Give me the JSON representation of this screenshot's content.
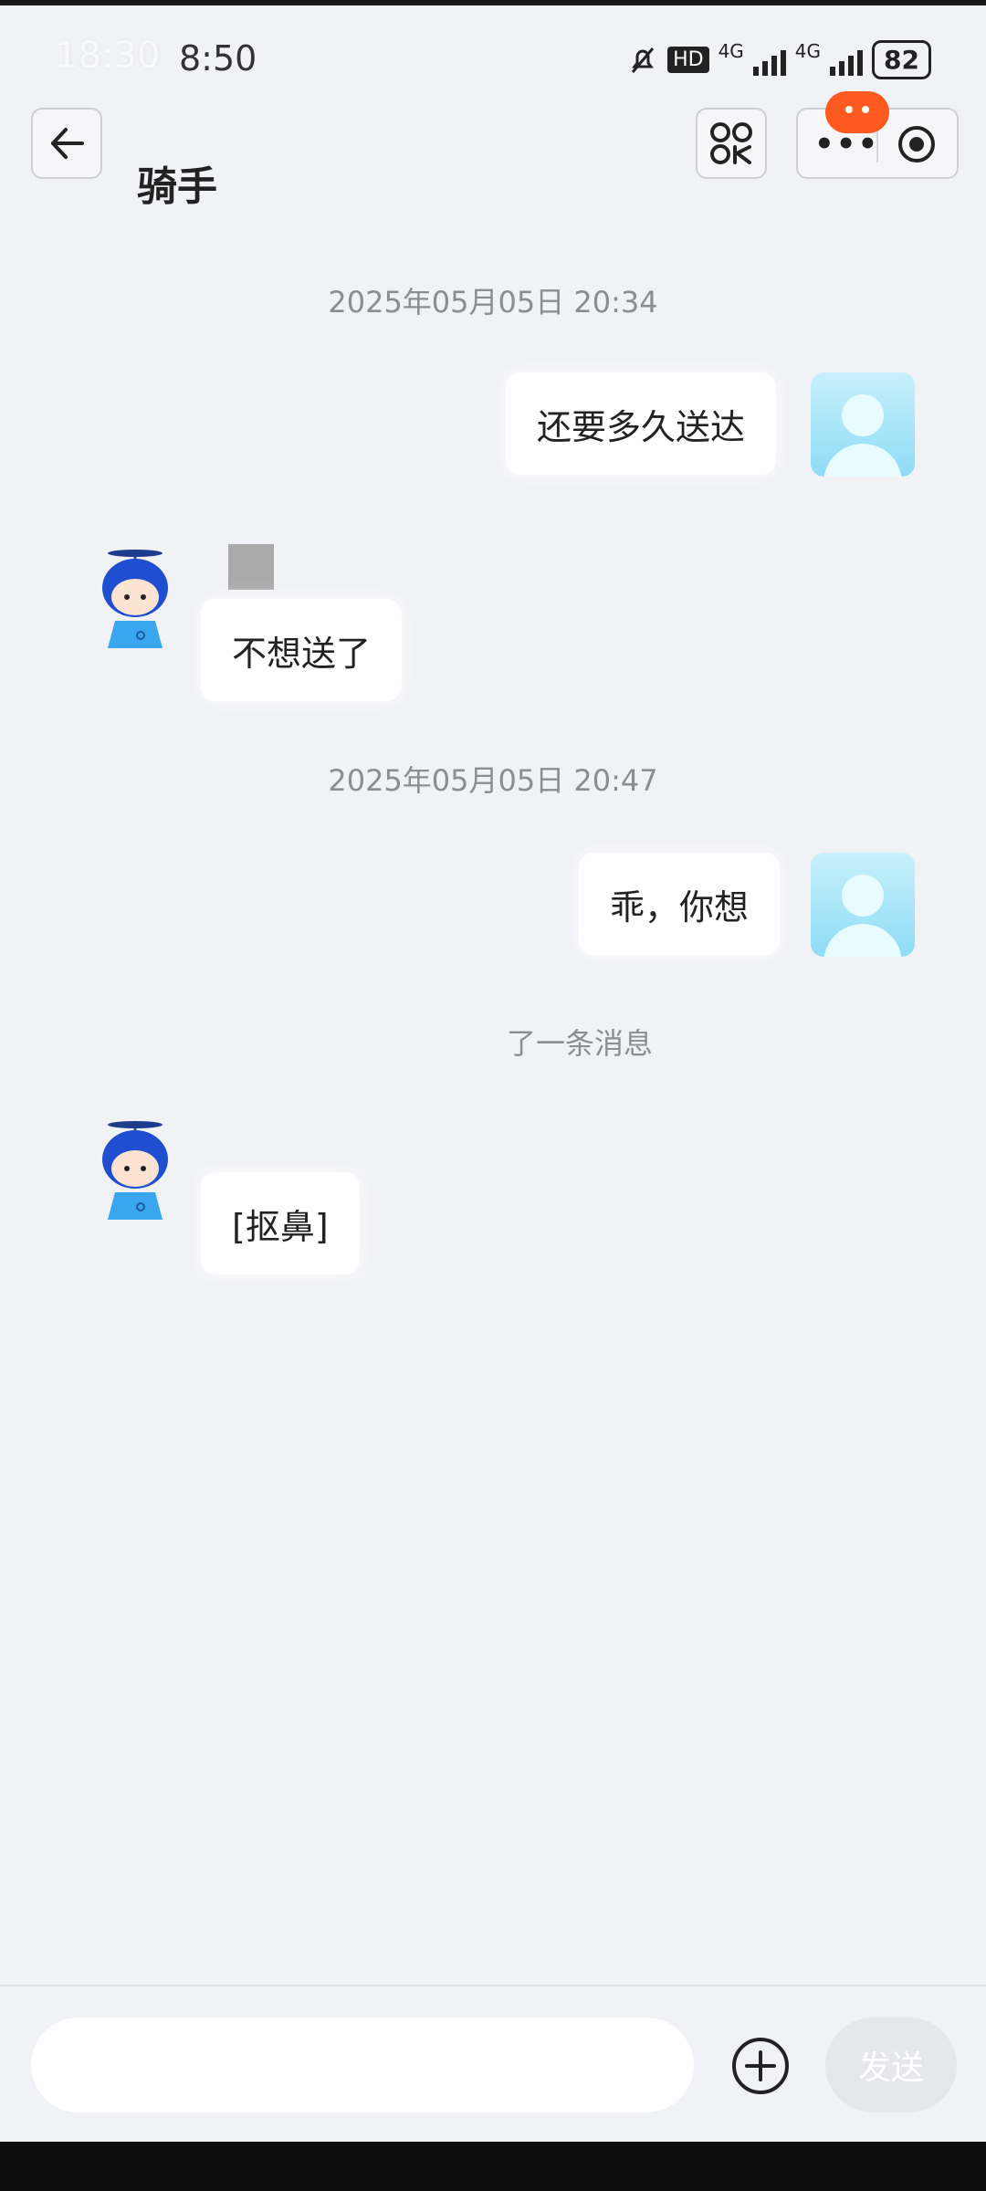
{
  "status_bar": {
    "time_ghost": "18:30",
    "time": "8:50",
    "network_hd": "HD",
    "network_1": "4G",
    "network_2": "4G",
    "battery": "82"
  },
  "header": {
    "title": "骑手",
    "back_icon": "arrow-left-icon",
    "qr_icon": "qr-code-icon",
    "more_icon": "more-dots-icon",
    "target_icon": "target-icon"
  },
  "messages": [
    {
      "type": "timestamp",
      "text": "2025年05月05日 20:34"
    },
    {
      "type": "outgoing",
      "text": "还要多久送达"
    },
    {
      "type": "incoming",
      "text": "不想送了"
    },
    {
      "type": "timestamp",
      "text": "2025年05月05日 20:47"
    },
    {
      "type": "outgoing",
      "text": "乖，你想"
    },
    {
      "type": "system",
      "text": "了一条消息"
    },
    {
      "type": "incoming",
      "text": "[抠鼻]"
    }
  ],
  "input": {
    "placeholder": "",
    "plus_icon": "plus-circle-icon",
    "send_label": "发送"
  },
  "colors": {
    "background": "#f1f2f6",
    "notification": "#ff5a1f",
    "send_disabled": "#e6e7eb"
  }
}
